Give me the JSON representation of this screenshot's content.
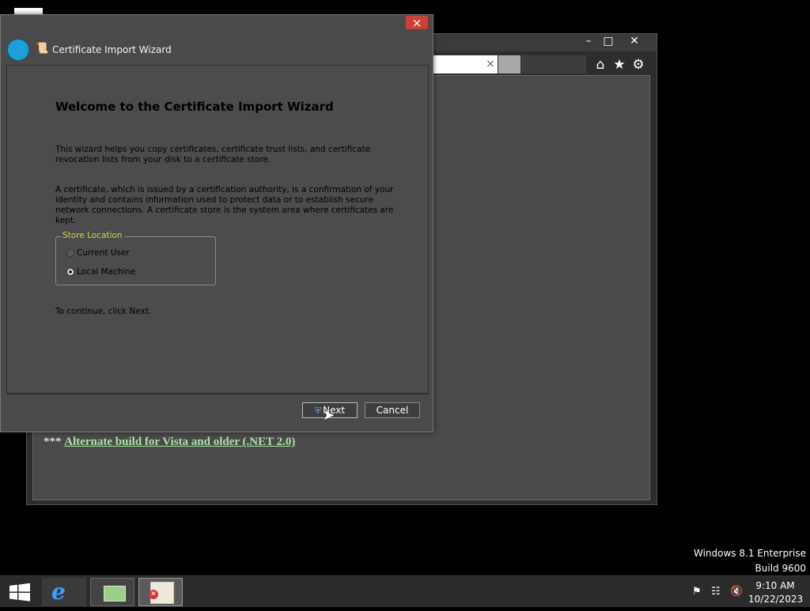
{
  "browser": {
    "address_clear": "×",
    "window_controls": [
      "minimize-icon",
      "maximize-icon",
      "close-icon"
    ],
    "toolbar_icons": [
      "home-icon",
      "star-icon",
      "gear-icon"
    ],
    "link_prefix": "***",
    "link_text": "Alternate build for Vista and older (.NET 2.0)"
  },
  "wizard": {
    "title": "Certificate Import Wizard",
    "close": "×",
    "heading": "Welcome to the Certificate Import Wizard",
    "para1": "This wizard helps you copy certificates, certificate trust lists, and certificate revocation lists from your disk to a certificate store.",
    "para2": "A certificate, which is issued by a certification authority, is a confirmation of your identity and contains information used to protect data or to establish secure network connections. A certificate store is the system area where certificates are kept.",
    "store_location": {
      "legend": "Store Location",
      "options": [
        {
          "label": "Current User",
          "selected": false
        },
        {
          "label": "Local Machine",
          "selected": true
        }
      ]
    },
    "continue_text": "To continue, click Next.",
    "next_label": "Next",
    "cancel_label": "Cancel"
  },
  "watermark": {
    "edition": "Windows 8.1 Enterprise",
    "build": "Build 9600"
  },
  "taskbar": {
    "items": [
      "internet-explorer",
      "graphics-app",
      "certificate-manager"
    ],
    "tray_icons": [
      "flag-icon",
      "network-icon",
      "volume-muted-icon"
    ],
    "time": "9:10 AM",
    "date": "10/22/2023"
  }
}
